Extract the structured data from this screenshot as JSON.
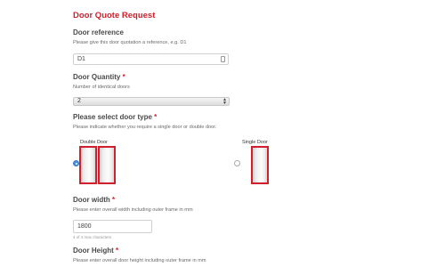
{
  "form": {
    "title": "Door Quote Request"
  },
  "door_reference": {
    "label": "Door reference",
    "hint": "Please give this door quotation a reference, e.g. D1",
    "value": "D1",
    "icon": "contact-card-icon"
  },
  "door_quantity": {
    "label": "Door Quantity",
    "required_mark": "*",
    "hint": "Number of identical doors",
    "value": "2",
    "icon": "spinner-arrows-icon"
  },
  "door_type": {
    "label": "Please select door type",
    "required_mark": "*",
    "hint": "Please indicate whether you require a single door or double door.",
    "options": [
      {
        "caption": "Double Door",
        "selected": true
      },
      {
        "caption": "Single Door",
        "selected": false
      }
    ],
    "accent_color": "#d0202e",
    "radio_color": "#4a90e2"
  },
  "door_width": {
    "label": "Door width",
    "required_mark": "*",
    "hint": "Please enter overall width including outer frame in mm",
    "value": "1800",
    "counter": "4 of 4 max characters"
  },
  "door_height": {
    "label": "Door Height",
    "required_mark": "*",
    "hint": "Please enter overall door height including outer frame in mm"
  }
}
